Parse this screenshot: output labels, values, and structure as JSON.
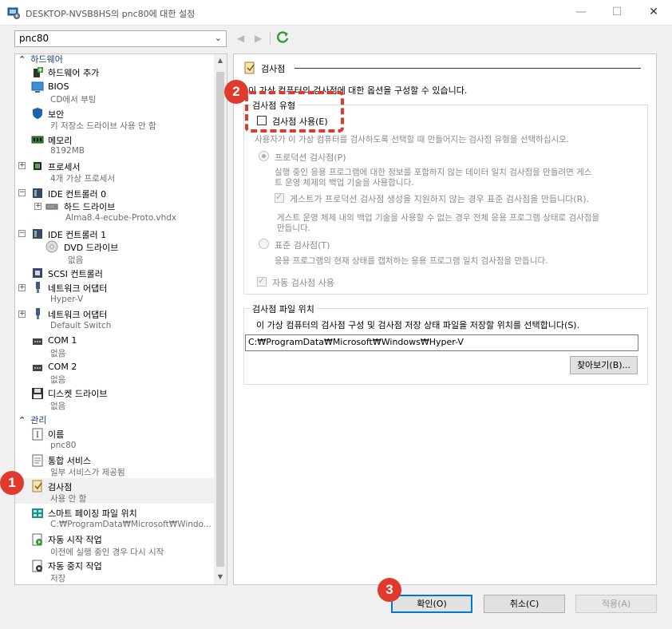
{
  "window": {
    "title": "DESKTOP-NVSB8HS의 pnc80에 대한 설정",
    "controls": [
      "—",
      "☐",
      "✕"
    ]
  },
  "vm_selector": {
    "value": "pnc80"
  },
  "tree": {
    "sections": {
      "hardware": "하드웨어",
      "management": "관리"
    },
    "items": [
      {
        "id": "add-hw",
        "label": "하드웨어 추가",
        "sub": ""
      },
      {
        "id": "bios",
        "label": "BIOS",
        "sub": "CD에서 부팅"
      },
      {
        "id": "security",
        "label": "보안",
        "sub": "키 저장소 드라이브 사용 안 함"
      },
      {
        "id": "memory",
        "label": "메모리",
        "sub": "8192MB"
      },
      {
        "id": "processor",
        "label": "프로세서",
        "sub": "4개 가상 프로세서"
      },
      {
        "id": "ide0",
        "label": "IDE 컨트롤러 0",
        "sub": ""
      },
      {
        "id": "hdd",
        "label": "하드 드라이브",
        "sub": "Alma8.4-ecube-Proto.vhdx"
      },
      {
        "id": "ide1",
        "label": "IDE 컨트롤러 1",
        "sub": ""
      },
      {
        "id": "dvd",
        "label": "DVD 드라이브",
        "sub": "없음"
      },
      {
        "id": "scsi",
        "label": "SCSI 컨트롤러",
        "sub": ""
      },
      {
        "id": "nic1",
        "label": "네트워크 어댑터",
        "sub": "Hyper-V"
      },
      {
        "id": "nic2",
        "label": "네트워크 어댑터",
        "sub": "Default Switch"
      },
      {
        "id": "com1",
        "label": "COM 1",
        "sub": "없음"
      },
      {
        "id": "com2",
        "label": "COM 2",
        "sub": "없음"
      },
      {
        "id": "floppy",
        "label": "디스켓 드라이브",
        "sub": "없음"
      },
      {
        "id": "name",
        "label": "이름",
        "sub": "pnc80"
      },
      {
        "id": "integration",
        "label": "통합 서비스",
        "sub": "일부 서비스가 제공됨"
      },
      {
        "id": "checkpoints",
        "label": "검사점",
        "sub": "사용 안 함"
      },
      {
        "id": "paging",
        "label": "스마트 페이징 파일 위치",
        "sub": "C:₩ProgramData₩Microsoft₩Windo..."
      },
      {
        "id": "autostart",
        "label": "자동 시작 작업",
        "sub": "이전에 실행 중인 경우 다시 시작"
      },
      {
        "id": "autostop",
        "label": "자동 중지 작업",
        "sub": "저장"
      }
    ]
  },
  "panel": {
    "title": "검사점",
    "intro": "이 가상 컴퓨터의 검사점에 대한 옵션을 구성할 수 있습니다.",
    "type_group": {
      "title": "검사점 유형",
      "enable_label": "검사점 사용(E)",
      "desc": "사용자가 이 가상 컴퓨터를 검사하도록 선택할 때 만들어지는 검사점 유형을 선택하십시오.",
      "production_label": "프로덕션 검사점(P)",
      "production_desc1": "실행 중인 응용 프로그램에 대한 정보를 포함하지 않는 데이터 일치 검사점을 만들려면 게스",
      "production_desc2": "트 운영 체제의 백업 기술을 사용합니다.",
      "fallback_label": "게스트가 프로덕션 검사점 생성을 지원하지 않는 경우 표준 검사점을 만듭니다(R).",
      "fallback_desc1": "게스트 운영 체제 내의 백업 기술을 사용할 수 없는 경우 전체 응용 프로그램 상태로 검사점을",
      "fallback_desc2": "만듭니다.",
      "standard_label": "표준 검사점(T)",
      "standard_desc": "응용 프로그램의 현재 상태를 캡처하는 응용 프로그램 일치 검사점을 만듭니다.",
      "auto_label": "자동 검사점 사용"
    },
    "location_group": {
      "title": "검사점 파일 위치",
      "desc": "이 가상 컴퓨터의 검사점 구성 및 검사점 저장 상태 파일을 저장할 위치를 선택합니다(S).",
      "path": "C:₩ProgramData₩Microsoft₩Windows₩Hyper-V",
      "browse_label": "찾아보기(B)..."
    }
  },
  "buttons": {
    "ok": "확인(O)",
    "cancel": "취소(C)",
    "apply": "적용(A)"
  },
  "annotations": {
    "b1": "1",
    "b2": "2",
    "b3": "3"
  },
  "colors": {
    "annotation": "#e03a2f",
    "section": "#1c3d7a"
  }
}
